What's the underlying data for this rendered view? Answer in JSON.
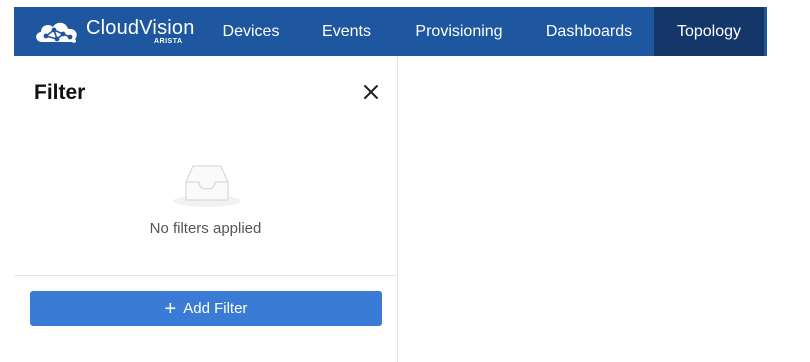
{
  "header": {
    "brand": {
      "name": "CloudVision",
      "sub": "ARISTA",
      "logo_icon": "cloud-network-icon"
    },
    "nav": [
      {
        "label": "Devices",
        "active": false
      },
      {
        "label": "Events",
        "active": false
      },
      {
        "label": "Provisioning",
        "active": false
      },
      {
        "label": "Dashboards",
        "active": false
      },
      {
        "label": "Topology",
        "active": true
      }
    ],
    "colors": {
      "bar": "#1e56a0",
      "active": "#143668"
    }
  },
  "filter_panel": {
    "title": "Filter",
    "close_icon": "close-icon",
    "empty_icon": "empty-inbox-icon",
    "empty_message": "No filters applied",
    "add_button": {
      "label": "Add Filter",
      "icon": "plus-icon",
      "color": "#3a7bd5"
    }
  }
}
